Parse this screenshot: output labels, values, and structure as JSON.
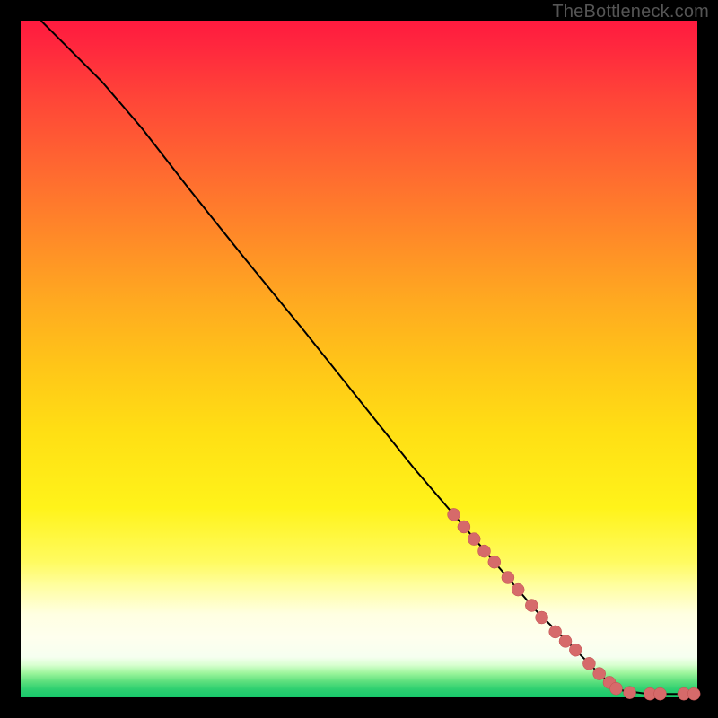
{
  "watermark": "TheBottleneck.com",
  "colors": {
    "marker": "#d66a6a",
    "marker_stroke": "#c05050",
    "curve": "#000000"
  },
  "chart_data": {
    "type": "line",
    "title": "",
    "xlabel": "",
    "ylabel": "",
    "xlim": [
      0,
      100
    ],
    "ylim": [
      0,
      100
    ],
    "grid": false,
    "legend": false,
    "description": "Diagonal bottleneck curve from top-left toward bottom-right that flattens along the bottom edge; salmon markers appear only along the lower-right portion of the curve.",
    "curve_points": [
      {
        "x": 3,
        "y": 100
      },
      {
        "x": 5,
        "y": 98
      },
      {
        "x": 8,
        "y": 95
      },
      {
        "x": 12,
        "y": 91
      },
      {
        "x": 18,
        "y": 84
      },
      {
        "x": 25,
        "y": 75
      },
      {
        "x": 33,
        "y": 65
      },
      {
        "x": 42,
        "y": 54
      },
      {
        "x": 50,
        "y": 44
      },
      {
        "x": 58,
        "y": 34
      },
      {
        "x": 64,
        "y": 27
      },
      {
        "x": 70,
        "y": 20
      },
      {
        "x": 76,
        "y": 13
      },
      {
        "x": 82,
        "y": 7
      },
      {
        "x": 86,
        "y": 3
      },
      {
        "x": 89,
        "y": 1
      },
      {
        "x": 92,
        "y": 0.6
      },
      {
        "x": 95,
        "y": 0.5
      },
      {
        "x": 98,
        "y": 0.5
      },
      {
        "x": 100,
        "y": 0.5
      }
    ],
    "markers": [
      {
        "x": 64,
        "y": 27
      },
      {
        "x": 65.5,
        "y": 25.2
      },
      {
        "x": 67,
        "y": 23.4
      },
      {
        "x": 68.5,
        "y": 21.6
      },
      {
        "x": 70,
        "y": 20
      },
      {
        "x": 72,
        "y": 17.7
      },
      {
        "x": 73.5,
        "y": 15.9
      },
      {
        "x": 75.5,
        "y": 13.6
      },
      {
        "x": 77,
        "y": 11.8
      },
      {
        "x": 79,
        "y": 9.7
      },
      {
        "x": 80.5,
        "y": 8.3
      },
      {
        "x": 82,
        "y": 7
      },
      {
        "x": 84,
        "y": 5
      },
      {
        "x": 85.5,
        "y": 3.5
      },
      {
        "x": 87,
        "y": 2.2
      },
      {
        "x": 88,
        "y": 1.3
      },
      {
        "x": 90,
        "y": 0.7
      },
      {
        "x": 93,
        "y": 0.5
      },
      {
        "x": 94.5,
        "y": 0.5
      },
      {
        "x": 98,
        "y": 0.5
      },
      {
        "x": 99.5,
        "y": 0.5
      }
    ],
    "marker_radius_px": 7
  }
}
